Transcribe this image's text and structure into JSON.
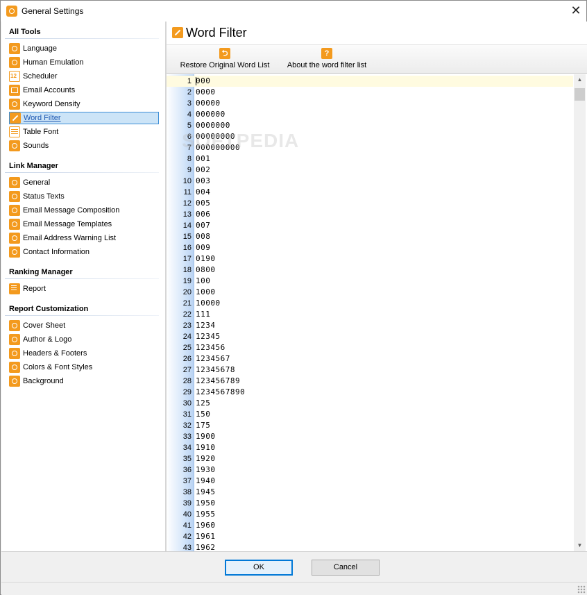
{
  "window": {
    "title": "General Settings",
    "close_glyph": "✕"
  },
  "sidebar": {
    "sections": [
      {
        "title": "All Tools",
        "items": [
          {
            "label": "Language",
            "icon": "gear-icon"
          },
          {
            "label": "Human Emulation",
            "icon": "gear-icon"
          },
          {
            "label": "Scheduler",
            "icon": "calendar-icon"
          },
          {
            "label": "Email Accounts",
            "icon": "mail-icon"
          },
          {
            "label": "Keyword Density",
            "icon": "gear-icon"
          },
          {
            "label": "Word Filter",
            "icon": "wrench-icon",
            "selected": true
          },
          {
            "label": "Table Font",
            "icon": "table-icon"
          },
          {
            "label": "Sounds",
            "icon": "gear-icon"
          }
        ]
      },
      {
        "title": "Link Manager",
        "items": [
          {
            "label": "General",
            "icon": "gear-icon"
          },
          {
            "label": "Status Texts",
            "icon": "gear-icon"
          },
          {
            "label": "Email Message Composition",
            "icon": "gear-icon"
          },
          {
            "label": "Email Message Templates",
            "icon": "gear-icon"
          },
          {
            "label": "Email Address Warning List",
            "icon": "gear-icon"
          },
          {
            "label": "Contact Information",
            "icon": "gear-icon"
          }
        ]
      },
      {
        "title": "Ranking Manager",
        "items": [
          {
            "label": "Report",
            "icon": "report-icon"
          }
        ]
      },
      {
        "title": "Report Customization",
        "items": [
          {
            "label": "Cover Sheet",
            "icon": "gear-icon"
          },
          {
            "label": "Author & Logo",
            "icon": "gear-icon"
          },
          {
            "label": "Headers & Footers",
            "icon": "gear-icon"
          },
          {
            "label": "Colors & Font Styles",
            "icon": "gear-icon"
          },
          {
            "label": "Background",
            "icon": "gear-icon"
          }
        ]
      }
    ]
  },
  "main": {
    "title": "Word Filter",
    "toolbar": {
      "restore_label": "Restore Original Word List",
      "restore_icon": "restore-icon",
      "about_label": "About the word filter list",
      "about_icon": "help-icon",
      "about_glyph": "?"
    },
    "editor": {
      "lines": [
        "000",
        "0000",
        "00000",
        "000000",
        "0000000",
        "00000000",
        "000000000",
        "001",
        "002",
        "003",
        "004",
        "005",
        "006",
        "007",
        "008",
        "009",
        "0190",
        "0800",
        "100",
        "1000",
        "10000",
        "111",
        "1234",
        "12345",
        "123456",
        "1234567",
        "12345678",
        "123456789",
        "1234567890",
        "125",
        "150",
        "175",
        "1900",
        "1910",
        "1920",
        "1930",
        "1940",
        "1945",
        "1950",
        "1955",
        "1960",
        "1961",
        "1962"
      ]
    }
  },
  "footer": {
    "ok_label": "OK",
    "cancel_label": "Cancel"
  },
  "colors": {
    "accent": "#f39a1e",
    "selection_border": "#3d8ed6",
    "selection_fill": "#cce4f7",
    "current_line": "#fffbe0"
  },
  "watermark": "SOFTPEDIA"
}
